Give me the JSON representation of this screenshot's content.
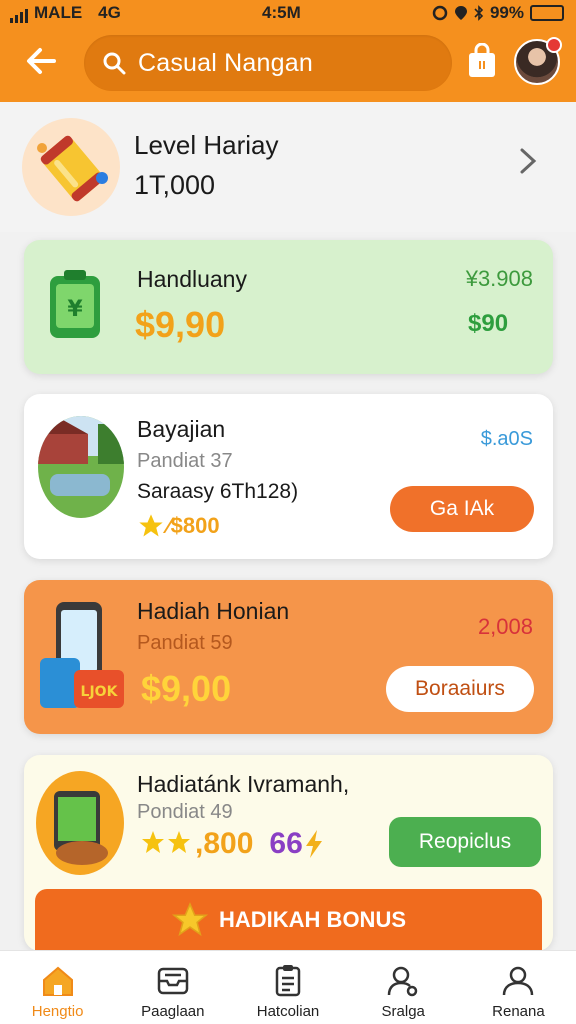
{
  "status": {
    "carrier": "MALE",
    "network": "4G",
    "time": "4:5M",
    "battery": "99%",
    "battery_level": 0.99
  },
  "header": {
    "search_text": "Casual Nangan"
  },
  "level": {
    "title": "Level Hariay",
    "amount": "1T,000"
  },
  "cards": [
    {
      "title": "Handluany",
      "price": "$9,90",
      "corner": "¥3.908",
      "badge": "$90"
    },
    {
      "title": "Bayajian",
      "subtitle": "Pandiat 37",
      "detail": "Saraasy 6Th128)",
      "rating": "⁄$800",
      "corner": "$.a0S",
      "button": "Ga IAk"
    },
    {
      "title": "Hadiah Honian",
      "subtitle": "Pandiat 59",
      "price": "$9,00",
      "corner": "2,008",
      "button": "Boraaiurs"
    },
    {
      "title": "Hadiatánk Ivramanh,",
      "subtitle": "Pondiat 49",
      "rating": ",800",
      "count": "66",
      "button": "Reopiclus",
      "bonus": "HADIKAH BONUS"
    }
  ],
  "nav": [
    {
      "label": "Hengtio",
      "icon": "home-icon",
      "active": true
    },
    {
      "label": "Paaglaan",
      "icon": "inbox-icon",
      "active": false
    },
    {
      "label": "Hatcolian",
      "icon": "clipboard-icon",
      "active": false
    },
    {
      "label": "Sralga",
      "icon": "user-search-icon",
      "active": false
    },
    {
      "label": "Renana",
      "icon": "profile-icon",
      "active": false
    }
  ],
  "colors": {
    "brand": "#f5901e",
    "green_card": "#d7f1cd",
    "orange_card": "#f5954a",
    "cta_orange": "#f06b1e",
    "cta_green": "#4caf50"
  }
}
